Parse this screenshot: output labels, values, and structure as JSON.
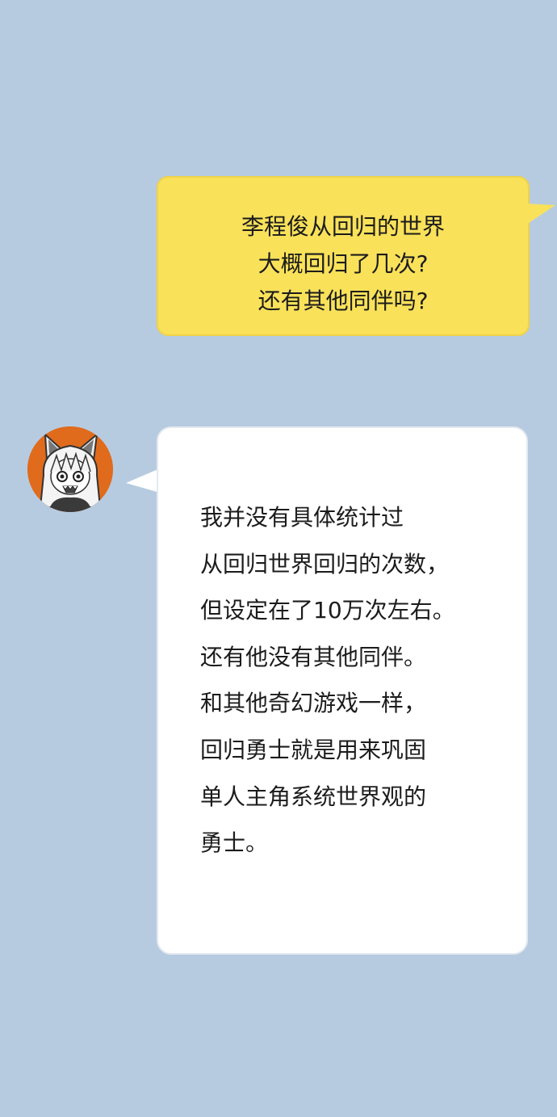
{
  "question": {
    "text": "李程俊从回归的世界\n大概回归了几次?\n还有其他同伴吗?"
  },
  "answer": {
    "avatar_icon": "wolf-girl-avatar-icon",
    "text": "我并没有具体统计过\n从回归世界回归的次数，\n但设定在了10万次左右。\n还有他没有其他同伴。\n和其他奇幻游戏一样，\n回归勇士就是用来巩固\n单人主角系统世界观的\n勇士。"
  },
  "colors": {
    "background": "#b7cbe0",
    "question_bubble": "#f9e15a",
    "answer_bubble": "#ffffff",
    "avatar_ring": "#e06b1c"
  }
}
